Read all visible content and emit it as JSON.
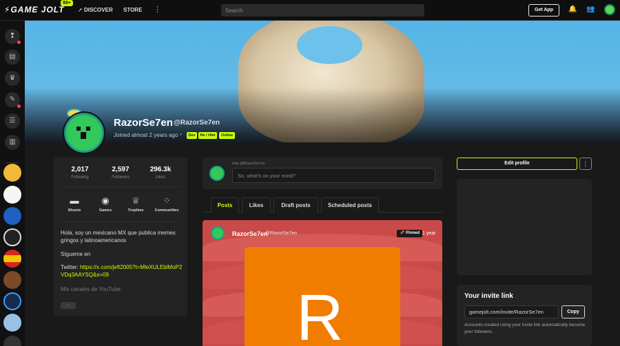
{
  "topbar": {
    "logo": "GAME JOLT",
    "badge": "99+",
    "discover": "DISCOVER",
    "store": "STORE",
    "more": "⋮",
    "search_placeholder": "Search",
    "get_app": "Get App"
  },
  "banner": {
    "image_desc": "rock arch under blue sky"
  },
  "profile": {
    "display_name": "RazorSe7en",
    "handle": "@RazorSe7en",
    "joined": "Joined almost 2 years ago",
    "separator": "•",
    "tags": [
      "Dev",
      "He / Him",
      "Online"
    ]
  },
  "stats": [
    {
      "value": "2,017",
      "label": "Following"
    },
    {
      "value": "2,597",
      "label": "Followers"
    },
    {
      "value": "296.3k",
      "label": "Likes"
    }
  ],
  "actions": [
    {
      "label": "Shouts",
      "icon": "shouts-icon"
    },
    {
      "label": "Games",
      "icon": "gamepad-icon"
    },
    {
      "label": "Trophies",
      "icon": "trophy-icon"
    },
    {
      "label": "Communities",
      "icon": "communities-icon"
    }
  ],
  "bio": {
    "line1": "Hola, soy un mexicano MX que publica memes gringos y latinoamericanos",
    "line2": "Sígueme en",
    "twitter_label": "Twitter: ",
    "twitter_link": "https://x.com/jeft2005?t=MleXULEblMoP2VDq3AAYSQ&s=09",
    "youtube": "Mis canales de YouTube:",
    "more_button": "..."
  },
  "composer": {
    "greeting": "Hey @RazorSe7en",
    "placeholder": "So, what's on your mind?"
  },
  "tabs": [
    "Posts",
    "Likes",
    "Draft posts",
    "Scheduled posts"
  ],
  "post": {
    "author": "RazorSe7en",
    "handle": "@RazorSe7en",
    "pinned": "Pinned",
    "time": "1 year",
    "tile_letter": "R"
  },
  "right": {
    "edit_profile": "Edit profile",
    "more": "⋮",
    "invite_title": "Your invite link",
    "invite_url": "gamejolt.com/invite/RazorSe7en",
    "copy": "Copy",
    "invite_note": "Accounts created using your invite link automatically become your followers."
  },
  "colors": {
    "accent": "#ccff00",
    "notification": "#ff3d6a",
    "avatar_green": "#32c85a",
    "post_red": "#c94a48",
    "tile_orange": "#f07c00"
  }
}
